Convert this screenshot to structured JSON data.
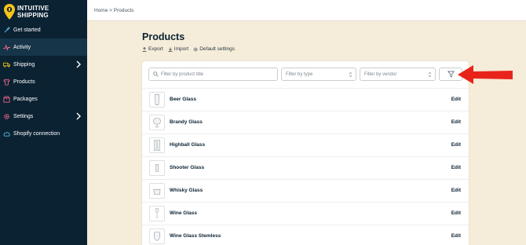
{
  "brand": {
    "line1": "INTUITIVE",
    "line2": "SHIPPING",
    "accent": "#f5c518"
  },
  "sidebar": {
    "items": [
      {
        "label": "Get started",
        "icon": "rocket-icon",
        "active": false
      },
      {
        "label": "Activity",
        "icon": "activity-icon",
        "active": true
      },
      {
        "label": "Shipping",
        "icon": "truck-icon",
        "has_children": true
      },
      {
        "label": "Products",
        "icon": "shirt-icon"
      },
      {
        "label": "Packages",
        "icon": "box-icon"
      },
      {
        "label": "Settings",
        "icon": "gear-icon",
        "has_children": true
      },
      {
        "label": "Shopify connection",
        "icon": "cloud-icon"
      }
    ]
  },
  "breadcrumb": {
    "text": "Home > Products"
  },
  "page": {
    "title": "Products"
  },
  "actions": {
    "export": "Export",
    "import": "Import",
    "default_settings": "Default settings"
  },
  "filters": {
    "search_placeholder": "Filter by product title",
    "type_placeholder": "Filter by type",
    "vendor_placeholder": "Filter by vendor"
  },
  "products": [
    {
      "name": "Beer Glass",
      "edit": "Edit"
    },
    {
      "name": "Brandy Glass",
      "edit": "Edit"
    },
    {
      "name": "Highball Glass",
      "edit": "Edit"
    },
    {
      "name": "Shooter Glass",
      "edit": "Edit"
    },
    {
      "name": "Whisky Glass",
      "edit": "Edit"
    },
    {
      "name": "Wine Glass",
      "edit": "Edit"
    },
    {
      "name": "Wine Glass Stemless",
      "edit": "Edit"
    }
  ],
  "colors": {
    "sidebar_bg": "#0b2233",
    "page_bg": "#f5ecd9",
    "arrow": "#e8241a",
    "icon_pink": "#ff6b8a"
  }
}
